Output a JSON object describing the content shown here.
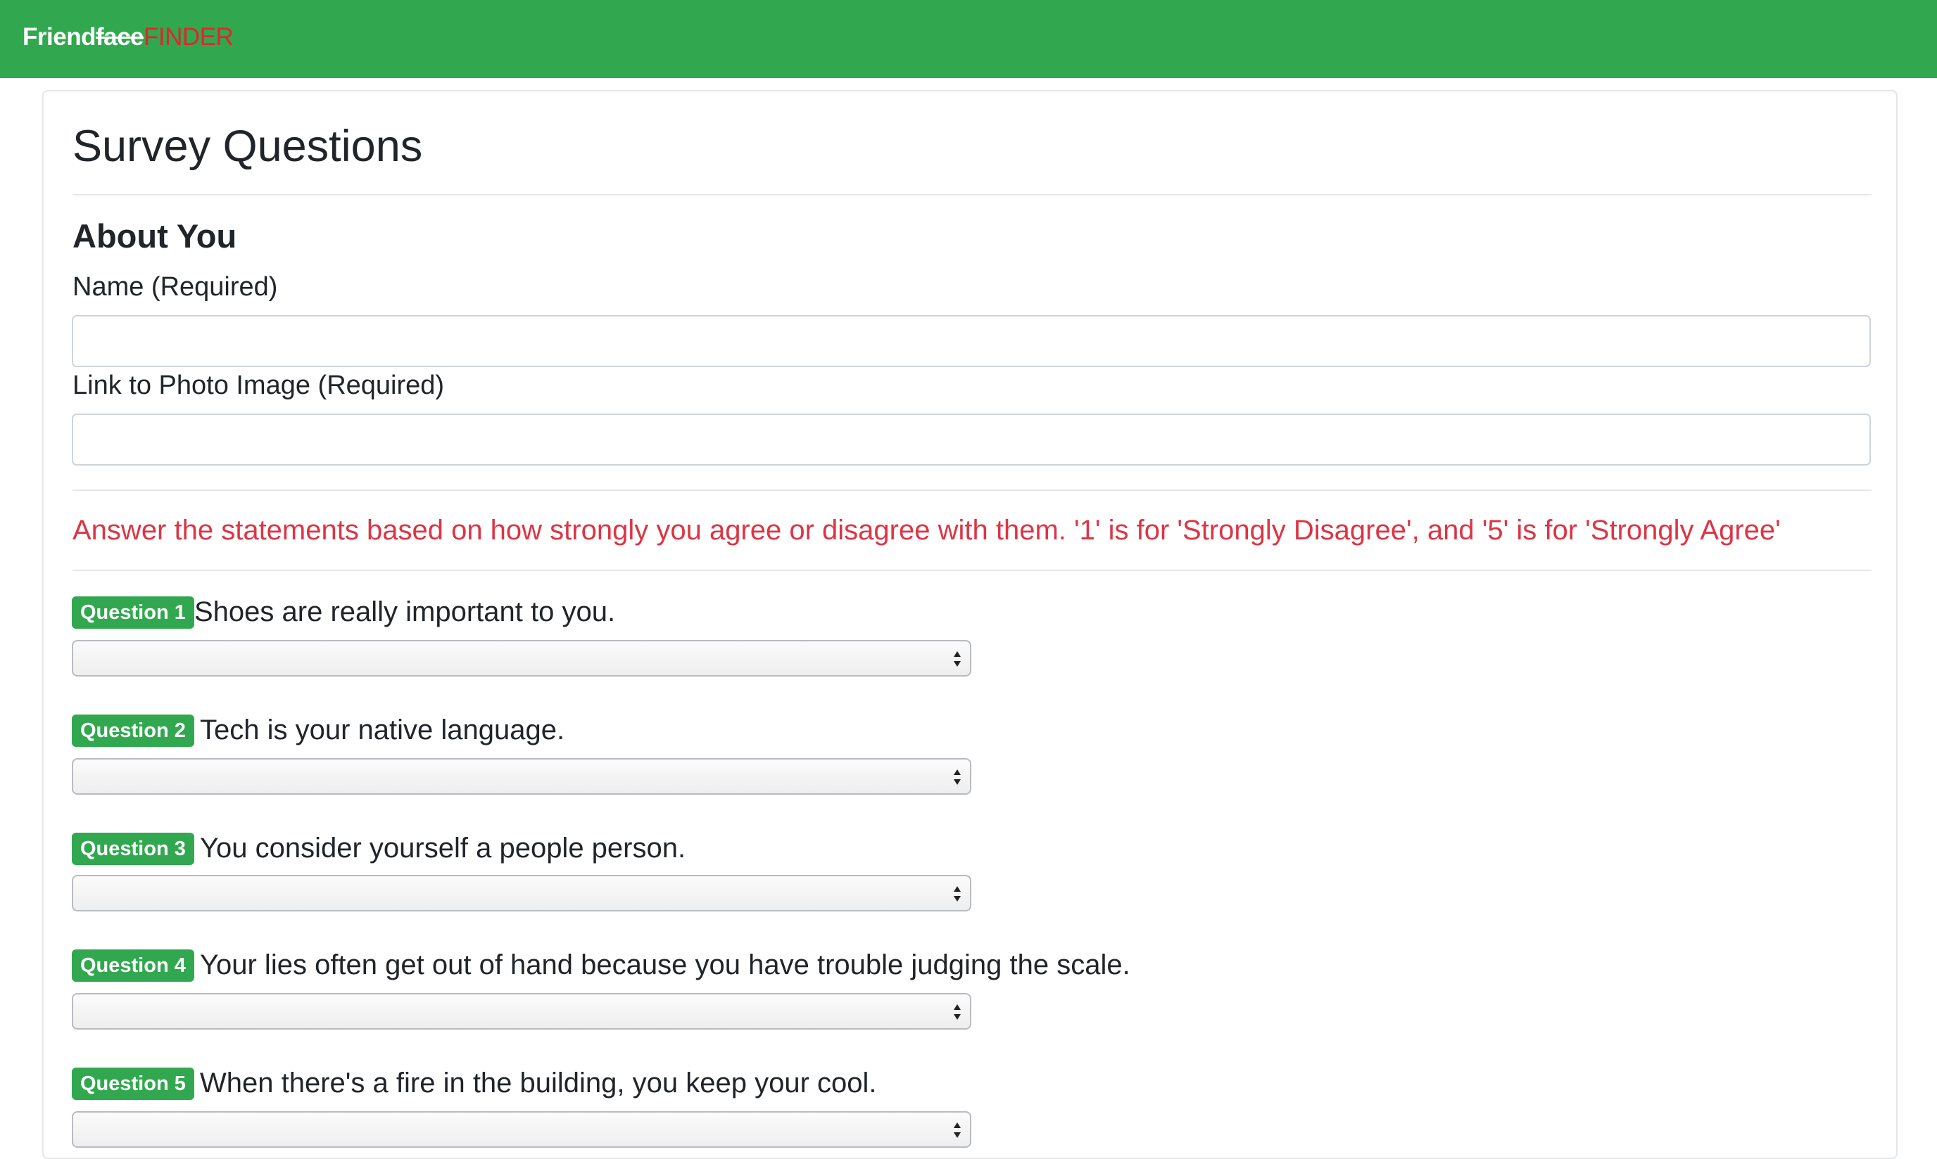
{
  "navbar": {
    "brand_part1": "Friend",
    "brand_part2": "face",
    "brand_part3": "FINDER",
    "background_color": "#31a84f",
    "brand_accent_color": "#e3242b"
  },
  "page": {
    "title": "Survey Questions"
  },
  "about": {
    "heading": "About You",
    "name_label": "Name (Required)",
    "name_value": "",
    "photo_label": "Link to Photo Image (Required)",
    "photo_value": ""
  },
  "instructions": {
    "text": "Answer the statements based on how strongly you agree or disagree with them. '1' is for 'Strongly Disagree', and '5' is for 'Strongly Agree'",
    "color": "#dc3545"
  },
  "questions": [
    {
      "badge": "Question 1",
      "text": "Shoes are really important to you.",
      "selected": ""
    },
    {
      "badge": "Question 2",
      "text": "Tech is your native language.",
      "selected": ""
    },
    {
      "badge": "Question 3",
      "text": "You consider yourself a people person.",
      "selected": ""
    },
    {
      "badge": "Question 4",
      "text": "Your lies often get out of hand because you have trouble judging the scale.",
      "selected": ""
    },
    {
      "badge": "Question 5",
      "text": "When there's a fire in the building, you keep your cool.",
      "selected": ""
    }
  ],
  "icons": {
    "select_arrows": "up-down-arrows-icon"
  }
}
